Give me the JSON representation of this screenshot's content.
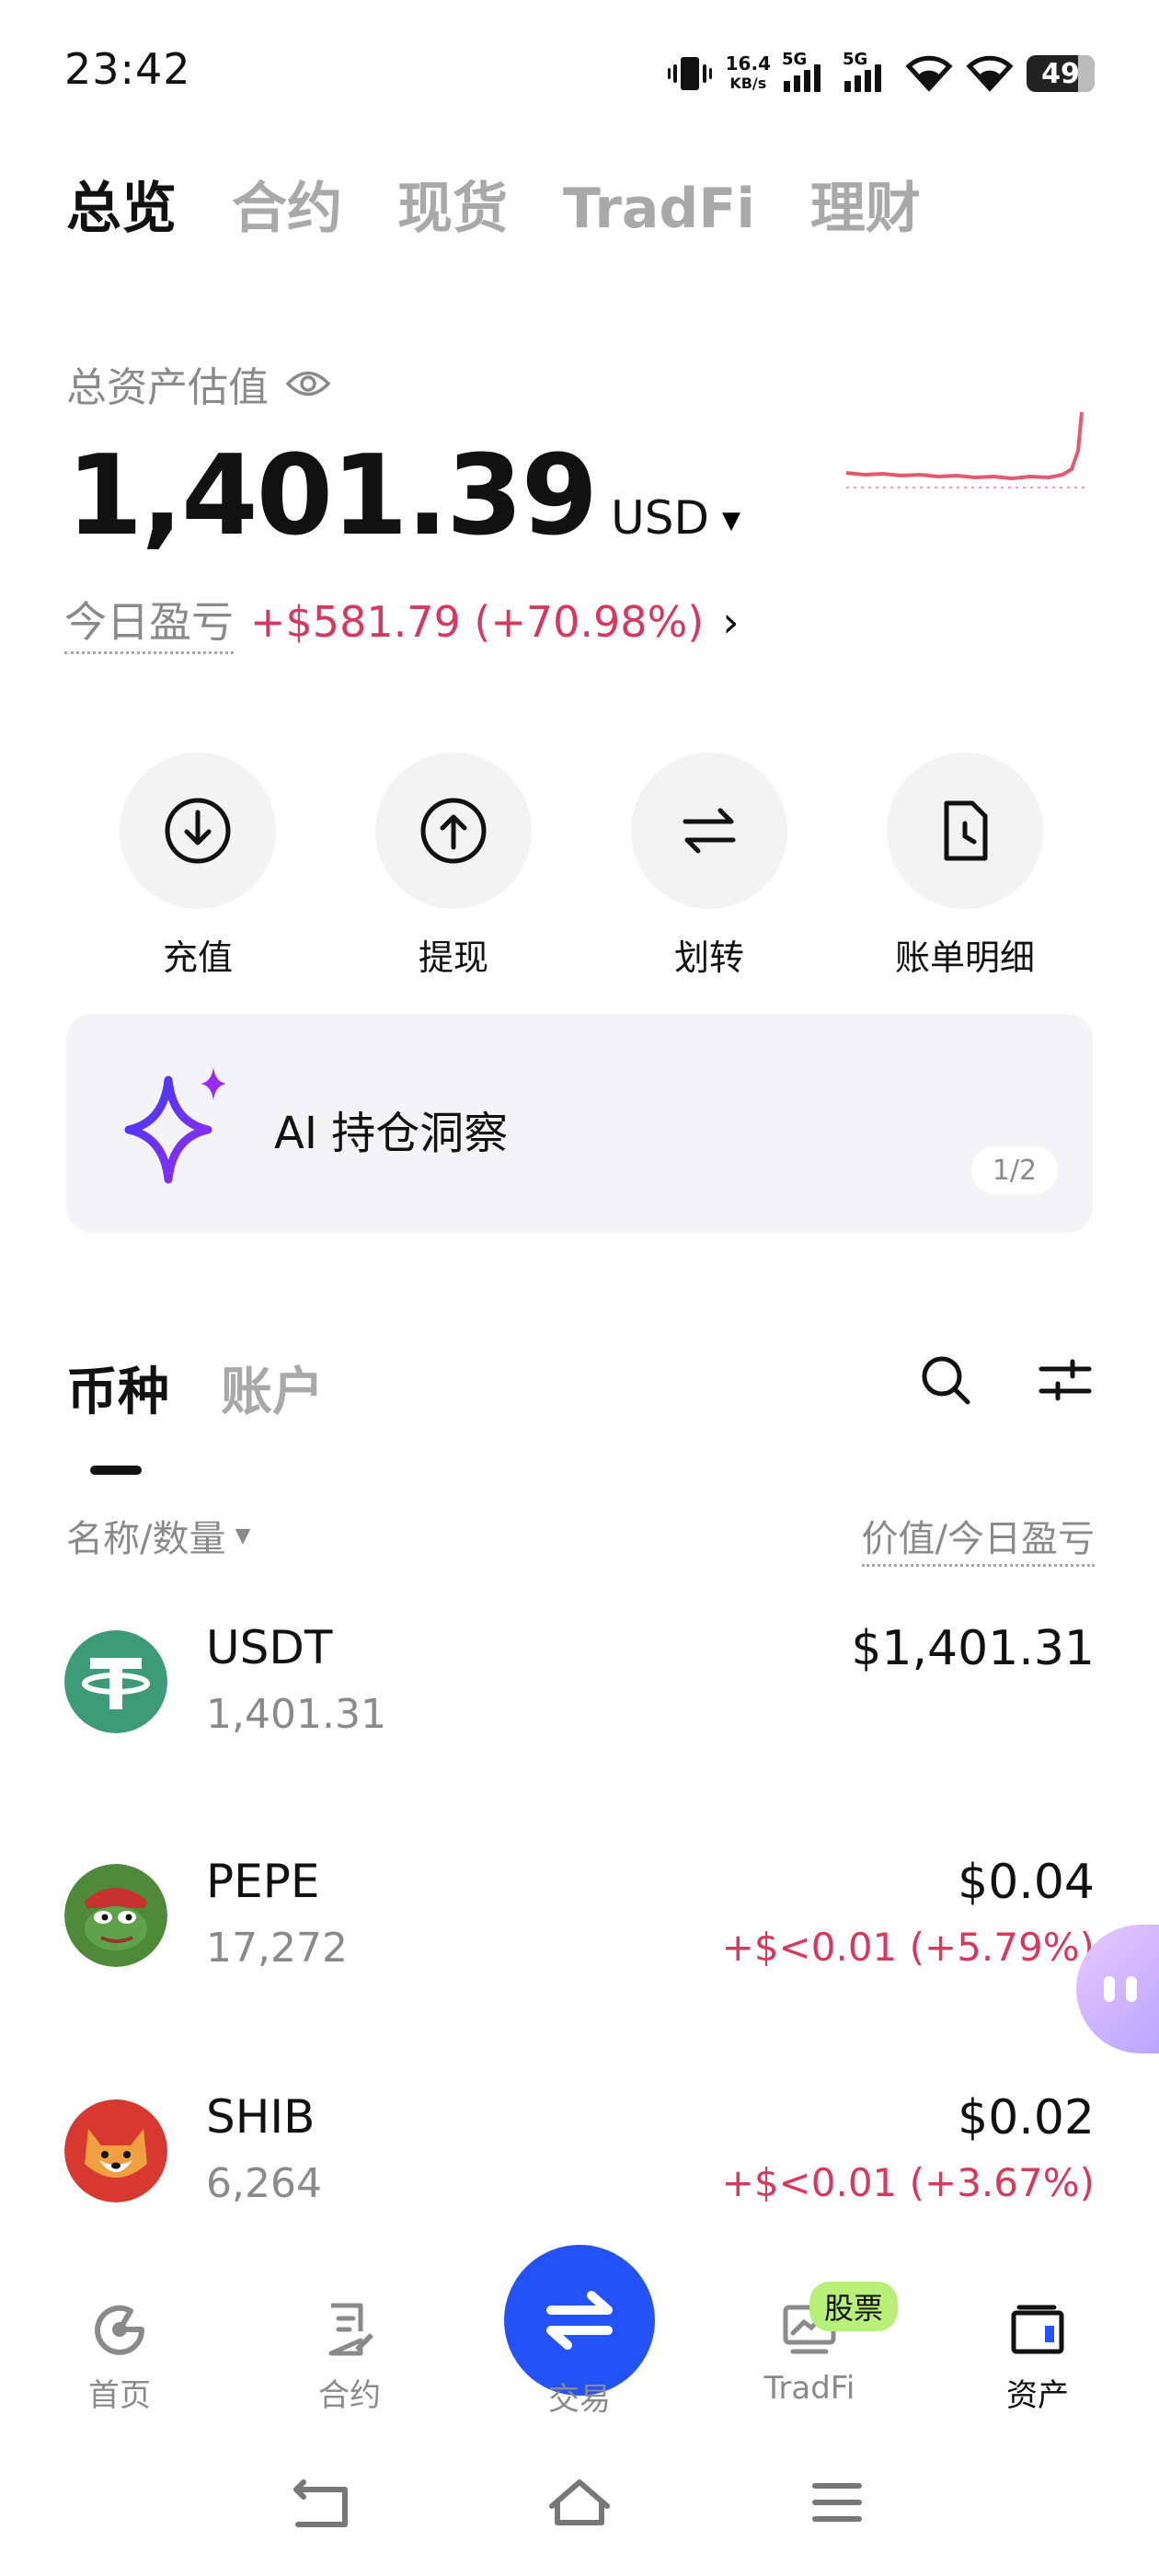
{
  "status_bar": {
    "time": "23:42",
    "net_speed_value": "16.4",
    "net_speed_unit": "KB/s",
    "sim1": "5G",
    "sim2": "5G",
    "battery": "49"
  },
  "top_tabs": [
    "总览",
    "合约",
    "现货",
    "TradFi",
    "理财"
  ],
  "active_top_tab": "总览",
  "asset": {
    "label": "总资产估值",
    "value": "1,401.39",
    "currency": "USD",
    "pnl_label": "今日盈亏",
    "pnl_value": "+$581.79 (+70.98%)"
  },
  "actions": [
    {
      "label": "充值",
      "icon": "deposit-icon"
    },
    {
      "label": "提现",
      "icon": "withdraw-icon"
    },
    {
      "label": "划转",
      "icon": "transfer-icon"
    },
    {
      "label": "账单明细",
      "icon": "bill-icon"
    }
  ],
  "ai_card": {
    "title": "AI 持仓洞察",
    "pager": "1/2"
  },
  "list": {
    "tabs": [
      "币种",
      "账户"
    ],
    "active_tab": "币种",
    "col_left": "名称/数量",
    "col_right": "价值/今日盈亏"
  },
  "coins": [
    {
      "symbol": "USDT",
      "quantity": "1,401.31",
      "value": "$1,401.31",
      "change": ""
    },
    {
      "symbol": "PEPE",
      "quantity": "17,272",
      "value": "$0.04",
      "change": "+$<0.01 (+5.79%)"
    },
    {
      "symbol": "SHIB",
      "quantity": "6,264",
      "value": "$0.02",
      "change": "+$<0.01 (+3.67%)"
    }
  ],
  "bottom_nav": {
    "home": "首页",
    "futures": "合约",
    "trade": "交易",
    "tradfi": "TradFi",
    "tradfi_badge": "股票",
    "assets": "资产"
  },
  "colors": {
    "accent_blue": "#2353f6",
    "profit_red": "#d7385e",
    "muted_gray": "#8a8a8a"
  }
}
